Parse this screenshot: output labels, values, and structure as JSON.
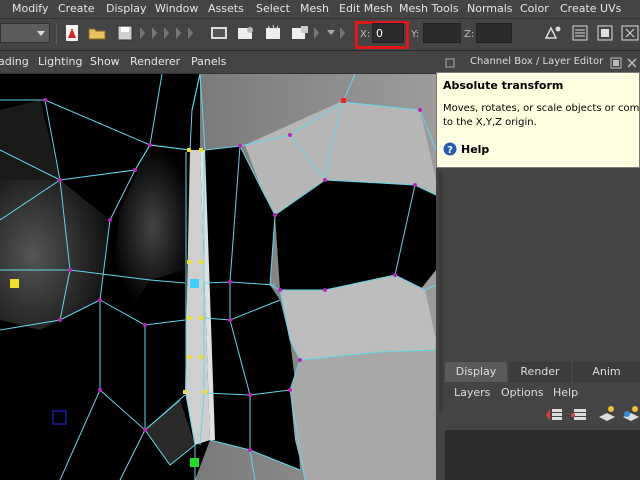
{
  "menubar": {
    "items": [
      "Modify",
      "Create",
      "Display",
      "Window",
      "Assets",
      "Select",
      "Mesh",
      "Edit Mesh",
      "Mesh Tools",
      "Normals",
      "Color",
      "Create UVs"
    ]
  },
  "toolbar": {
    "x_label": "X:",
    "x_value": "0",
    "y_label": "Y:",
    "y_value": "",
    "z_label": "Z:",
    "z_value": "",
    "highlight_color": "#e0161b"
  },
  "viewport_menu": {
    "items": [
      "ading",
      "Lighting",
      "Show",
      "Renderer",
      "Panels"
    ]
  },
  "tooltip": {
    "title": "Absolute transform",
    "line1": "Moves, rotates, or scale objects or compo",
    "line2": "to the X,Y,Z origin.",
    "help_label": "Help"
  },
  "right_panel": {
    "header": "Channel Box / Layer Editor",
    "tabs": [
      "Display",
      "Render",
      "Anim"
    ],
    "menu_items": [
      "Layers",
      "Options",
      "Help"
    ]
  },
  "colors": {
    "wire": "#5fd8e8",
    "vertex": "#c020c0",
    "selected_vertex": "#f0e020",
    "green_vertex": "#22dd22",
    "red_vertex": "#ff2020",
    "cyan_vertex": "#40d0ff",
    "panel_bg": "#444444",
    "tooltip_bg": "#ffffe1"
  }
}
